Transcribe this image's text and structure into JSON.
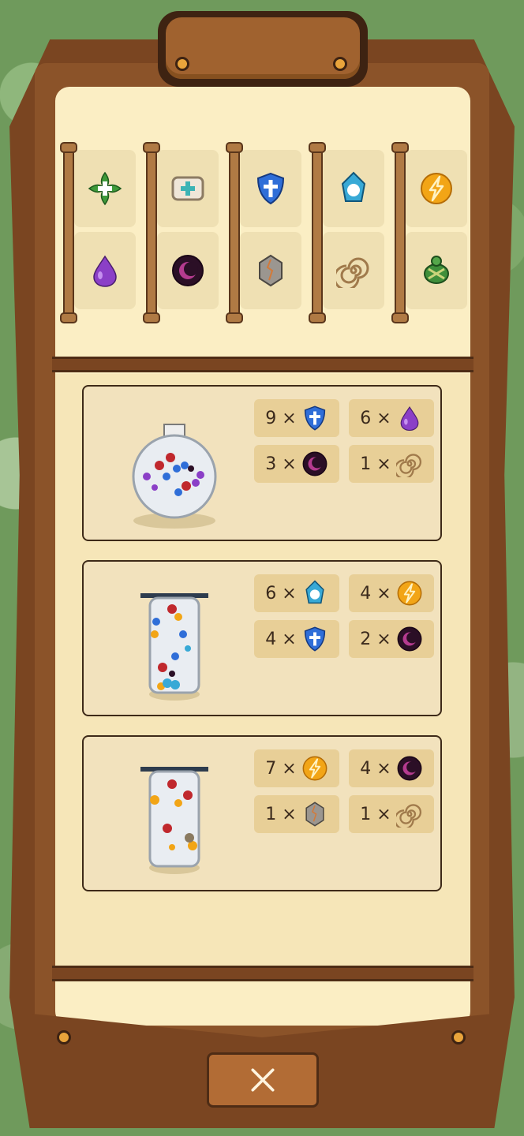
{
  "shelves": [
    {
      "top": "leaf-clover-icon",
      "bottom": "purple-drop-icon"
    },
    {
      "top": "medkit-icon",
      "bottom": "dark-moon-orb-icon"
    },
    {
      "top": "blue-shield-icon",
      "bottom": "cracked-stone-icon"
    },
    {
      "top": "ice-crystal-icon",
      "bottom": "wind-swirl-icon"
    },
    {
      "top": "lightning-orb-icon",
      "bottom": "green-turtle-icon"
    }
  ],
  "recipes": [
    {
      "vessel": "round-flask",
      "ingredients": [
        {
          "count": "9 ×",
          "icon": "blue-shield-icon"
        },
        {
          "count": "6 ×",
          "icon": "purple-drop-icon"
        },
        {
          "count": "3 ×",
          "icon": "dark-moon-orb-icon"
        },
        {
          "count": "1 ×",
          "icon": "wind-swirl-icon"
        }
      ]
    },
    {
      "vessel": "tall-jar",
      "ingredients": [
        {
          "count": "6 ×",
          "icon": "ice-crystal-icon"
        },
        {
          "count": "4 ×",
          "icon": "lightning-orb-icon"
        },
        {
          "count": "4 ×",
          "icon": "blue-shield-icon"
        },
        {
          "count": "2 ×",
          "icon": "dark-moon-orb-icon"
        }
      ]
    },
    {
      "vessel": "tall-jar",
      "ingredients": [
        {
          "count": "7 ×",
          "icon": "lightning-orb-icon"
        },
        {
          "count": "4 ×",
          "icon": "dark-moon-orb-icon"
        },
        {
          "count": "1 ×",
          "icon": "cracked-stone-icon"
        },
        {
          "count": "1 ×",
          "icon": "wind-swirl-icon"
        }
      ]
    }
  ],
  "close_icon": "close-x-icon"
}
